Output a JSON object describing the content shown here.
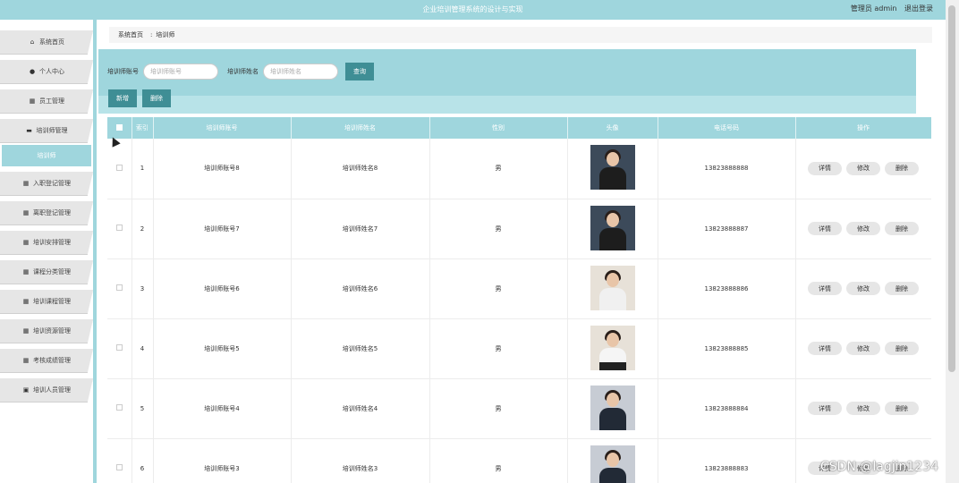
{
  "header": {
    "title": "企业培训管理系统的设计与实现",
    "role_label": "管理员 admin",
    "logout_label": "退出登录"
  },
  "sidebar": {
    "items": [
      {
        "label": "系统首页",
        "icon": "home-icon"
      },
      {
        "label": "个人中心",
        "icon": "user-icon"
      },
      {
        "label": "员工管理",
        "icon": "grid-icon"
      },
      {
        "label": "培训师管理",
        "icon": "briefcase-icon"
      },
      {
        "label": "培训师",
        "icon": ""
      },
      {
        "label": "入职登记管理",
        "icon": "grid-icon"
      },
      {
        "label": "离职登记管理",
        "icon": "grid-icon"
      },
      {
        "label": "培训安排管理",
        "icon": "grid-icon"
      },
      {
        "label": "课程分类管理",
        "icon": "grid-icon"
      },
      {
        "label": "培训课程管理",
        "icon": "grid-icon"
      },
      {
        "label": "培训资源管理",
        "icon": "grid-icon"
      },
      {
        "label": "考核成绩管理",
        "icon": "grid-icon"
      },
      {
        "label": "培训人员管理",
        "icon": "clipboard-icon"
      }
    ]
  },
  "breadcrumb": {
    "home": "系统首页",
    "separator": ":",
    "current": "培训师"
  },
  "search": {
    "account_label": "培训师账号",
    "account_placeholder": "培训师账号",
    "name_label": "培训师姓名",
    "name_placeholder": "培训师姓名",
    "button": "查询"
  },
  "actions": {
    "add": "新增",
    "delete": "删除"
  },
  "table": {
    "headers": [
      "",
      "索引",
      "培训师账号",
      "培训师姓名",
      "性别",
      "头像",
      "电话号码",
      "操作"
    ],
    "row_buttons": [
      "详情",
      "修改",
      "删除"
    ],
    "rows": [
      {
        "index": "1",
        "account": "培训师账号8",
        "name": "培训师姓名8",
        "gender": "男",
        "phone": "13823888888"
      },
      {
        "index": "2",
        "account": "培训师账号7",
        "name": "培训师姓名7",
        "gender": "男",
        "phone": "13823888887"
      },
      {
        "index": "3",
        "account": "培训师账号6",
        "name": "培训师姓名6",
        "gender": "男",
        "phone": "13823888886"
      },
      {
        "index": "4",
        "account": "培训师账号5",
        "name": "培训师姓名5",
        "gender": "男",
        "phone": "13823888885"
      },
      {
        "index": "5",
        "account": "培训师账号4",
        "name": "培训师姓名4",
        "gender": "男",
        "phone": "13823888884"
      },
      {
        "index": "6",
        "account": "培训师账号3",
        "name": "培训师姓名3",
        "gender": "男",
        "phone": "13823888883"
      }
    ]
  },
  "watermark": "CSDN @lagjin1234",
  "colors": {
    "accent": "#9fd6dd",
    "button_dark": "#3f8e95"
  }
}
